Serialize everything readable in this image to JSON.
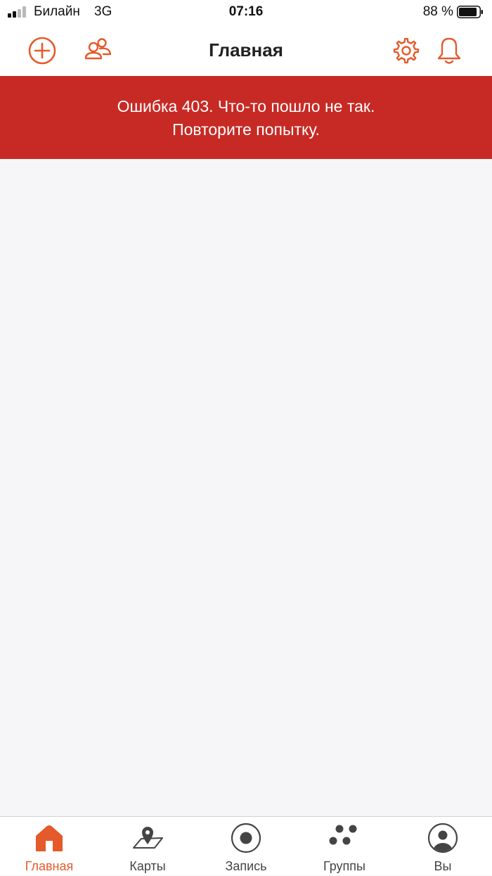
{
  "status_bar": {
    "carrier": "Билайн",
    "network": "3G",
    "time": "07:16",
    "battery_percent": "88 %",
    "battery_level": 0.88,
    "signal_bars_filled": 2,
    "signal_bars_total": 4
  },
  "nav": {
    "title": "Главная",
    "icons": [
      "plus-circle-icon",
      "people-icon",
      "gear-icon",
      "bell-icon"
    ]
  },
  "error": {
    "line1": "Ошибка 403. Что-то пошло не так.",
    "line2": "Повторите попытку."
  },
  "tabs": [
    {
      "label": "Главная",
      "icon": "home-icon",
      "active": true
    },
    {
      "label": "Карты",
      "icon": "map-icon",
      "active": false
    },
    {
      "label": "Запись",
      "icon": "record-icon",
      "active": false
    },
    {
      "label": "Группы",
      "icon": "groups-icon",
      "active": false
    },
    {
      "label": "Вы",
      "icon": "profile-icon",
      "active": false
    }
  ],
  "colors": {
    "accent": "#e45a2b",
    "error_background": "#c72a24",
    "inactive_tab": "#444444",
    "content_background": "#f6f6f8"
  }
}
